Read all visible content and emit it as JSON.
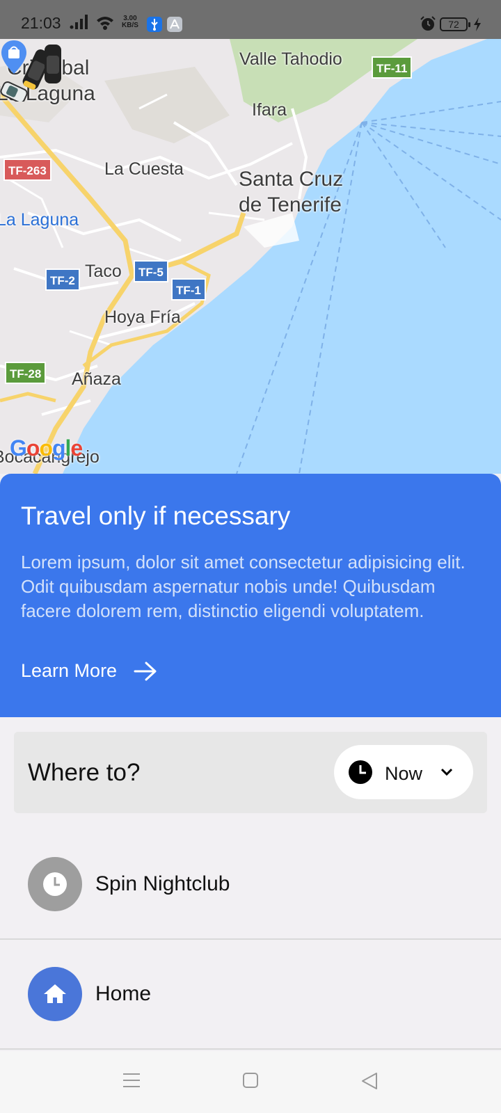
{
  "status_bar": {
    "time": "21:03",
    "net_speed_value": "3.00",
    "net_speed_unit": "KB/S",
    "battery": "72"
  },
  "map": {
    "labels": {
      "cristobal_line1": "Cristóbal",
      "cristobal_line2": "La Laguna",
      "valle_tahodio": "Valle Tahodio",
      "ifara": "Ifara",
      "la_cuesta": "La Cuesta",
      "santa_cruz_line1": "Santa Cruz",
      "santa_cruz_line2": "de Tenerife",
      "la_laguna": "La Laguna",
      "taco": "Taco",
      "hoya_fria": "Hoya Fría",
      "anaza": "Añaza",
      "bocacangrejo": "Bocacangrejo"
    },
    "road_shields": {
      "tf11": "TF-11",
      "tf263": "TF-263",
      "tf2": "TF-2",
      "tf5": "TF-5",
      "tf1": "TF-1",
      "tf28": "TF-28"
    },
    "attribution": "Google",
    "colors": {
      "land": "#ebe8ea",
      "water": "#aadaff",
      "highway": "#f7d36b",
      "green_area": "#c8dfb6",
      "shield_green": "#5b9b3c",
      "shield_blue": "#3f76c4",
      "shield_red": "#d85a5a"
    }
  },
  "travel_card": {
    "title": "Travel only if necessary",
    "body": "Lorem ipsum, dolor sit amet consectetur adipisicing elit. Odit quibusdam aspernatur nobis unde! Quibusdam facere dolorem rem, distinctio eligendi voluptatem.",
    "link_label": "Learn More",
    "color": "#3b77ec"
  },
  "search": {
    "placeholder": "Where to?",
    "time_label": "Now"
  },
  "destinations": [
    {
      "label": "Spin Nightclub",
      "icon": "clock-icon",
      "icon_color": "#9e9e9e"
    },
    {
      "label": "Home",
      "icon": "home-icon",
      "icon_color": "#4a76d9"
    }
  ],
  "nav_bar": {
    "buttons": [
      "menu-icon",
      "home-square-icon",
      "back-triangle-icon"
    ]
  }
}
